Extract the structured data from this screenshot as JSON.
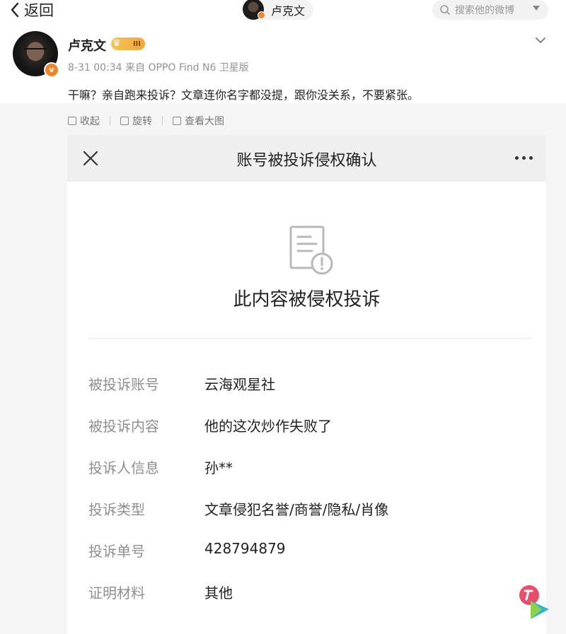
{
  "topbar": {
    "back_label": "返回",
    "user_name": "卢克文",
    "search_placeholder": "搜索他的微博"
  },
  "post": {
    "author": "卢克文",
    "level_badge": "III",
    "meta": "8-31 00:34  来自 OPPO Find N6 卫星版",
    "text": "干嘛？亲自跑来投诉？文章连你名字都没提，跟你没关系，不要紧张。"
  },
  "image_tools": {
    "collapse": "收起",
    "rotate": "旋转",
    "view_large": "查看大图"
  },
  "screenshot": {
    "title": "账号被投诉侵权确认",
    "heading": "此内容被侵权投诉",
    "rows": [
      {
        "k": "被投诉账号",
        "v": "云海观星社"
      },
      {
        "k": "被投诉内容",
        "v": "他的这次炒作失败了"
      },
      {
        "k": "投诉人信息",
        "v": "孙**"
      },
      {
        "k": "投诉类型",
        "v": "文章侵犯名誉/商誉/隐私/肖像"
      },
      {
        "k": "投诉单号",
        "v": "428794879"
      },
      {
        "k": "证明材料",
        "v": "其他"
      }
    ]
  },
  "colors": {
    "accent_orange": "#f0862a",
    "muted_text": "#939393",
    "header_bg": "#efefef"
  }
}
